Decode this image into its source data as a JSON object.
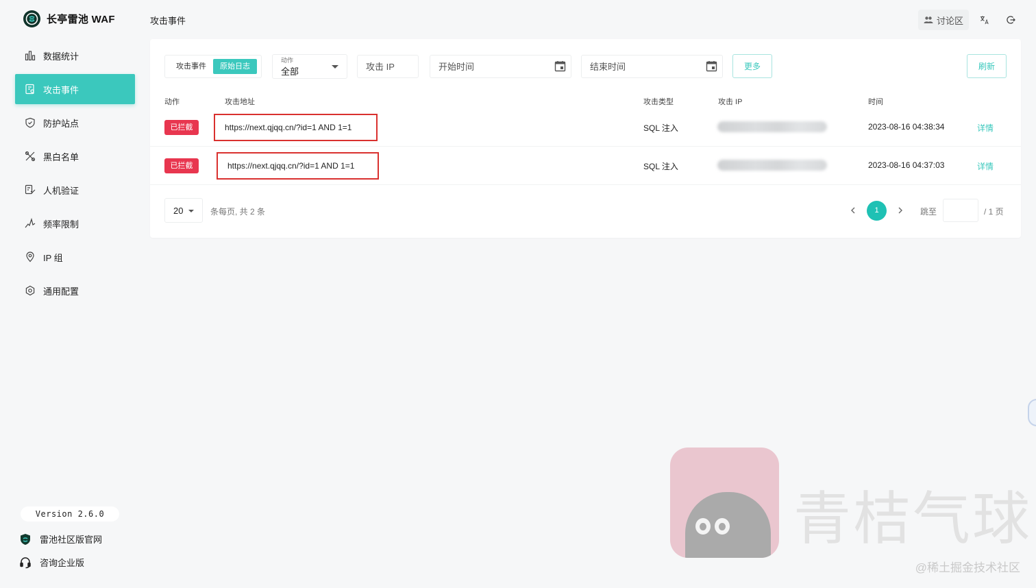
{
  "brand": {
    "name": "长亭雷池 WAF"
  },
  "sidebar": {
    "items": [
      {
        "label": "数据统计",
        "icon": "bar-chart-icon",
        "active": false
      },
      {
        "label": "攻击事件",
        "icon": "document-icon",
        "active": true
      },
      {
        "label": "防护站点",
        "icon": "shield-icon",
        "active": false
      },
      {
        "label": "黑白名单",
        "icon": "tools-icon",
        "active": false
      },
      {
        "label": "人机验证",
        "icon": "verify-icon",
        "active": false
      },
      {
        "label": "频率限制",
        "icon": "pulse-icon",
        "active": false
      },
      {
        "label": "IP 组",
        "icon": "location-pin-icon",
        "active": false
      },
      {
        "label": "通用配置",
        "icon": "settings-icon",
        "active": false
      }
    ],
    "version": "Version 2.6.0",
    "links": {
      "official": "雷池社区版官网",
      "enterprise": "咨询企业版"
    }
  },
  "header": {
    "title": "攻击事件",
    "forum": "讨论区"
  },
  "filters": {
    "tabs": [
      "攻击事件",
      "原始日志"
    ],
    "active_tab": 1,
    "action_label": "动作",
    "action_value": "全部",
    "ip_placeholder": "攻击 IP",
    "start_placeholder": "开始时间",
    "end_placeholder": "结束时间",
    "more": "更多",
    "refresh": "刷新"
  },
  "table": {
    "columns": [
      "动作",
      "攻击地址",
      "攻击类型",
      "攻击 IP",
      "时间"
    ],
    "rows": [
      {
        "action": "已拦截",
        "url": "https://next.qjqq.cn/?id=1 AND 1=1",
        "type": "SQL 注入",
        "time": "2023-08-16 04:38:34",
        "detail": "详情"
      },
      {
        "action": "已拦截",
        "url": "https://next.qjqq.cn/?id=1 AND 1=1",
        "type": "SQL 注入",
        "time": "2023-08-16 04:37:03",
        "detail": "详情"
      }
    ]
  },
  "pagination": {
    "page_size": "20",
    "summary": "条每页, 共 2 条",
    "current": "1",
    "jump_label": "跳至",
    "total_pages": "/ 1 页"
  },
  "watermark": {
    "text": "青桔气球",
    "sub": "@稀土掘金技术社区"
  },
  "colors": {
    "accent": "#3bc8bd",
    "danger": "#e8364f",
    "highlight_border": "#d9302e"
  }
}
